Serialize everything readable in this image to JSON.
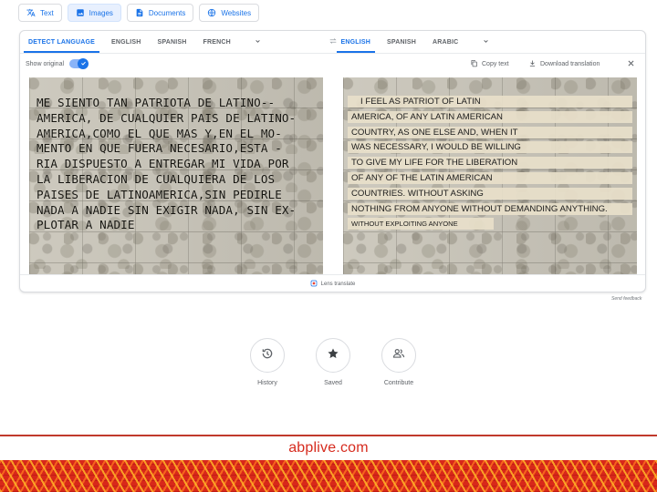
{
  "modes": [
    {
      "label": "Text",
      "icon": "translate-icon",
      "active": false
    },
    {
      "label": "Images",
      "icon": "image-icon",
      "active": true
    },
    {
      "label": "Documents",
      "icon": "document-icon",
      "active": false
    },
    {
      "label": "Websites",
      "icon": "globe-icon",
      "active": false
    }
  ],
  "source_langs": [
    "DETECT LANGUAGE",
    "ENGLISH",
    "SPANISH",
    "FRENCH"
  ],
  "target_langs": [
    "ENGLISH",
    "SPANISH",
    "ARABIC"
  ],
  "options": {
    "show_original": "Show original",
    "show_original_on": true,
    "copy_text": "Copy text",
    "download": "Download translation"
  },
  "original_lines": [
    " ME SIENTO TAN PATRIOTA DE LATINO--",
    "AMERICA, DE CUALQUIER PAIS DE LATINO-",
    "AMERICA,COMO EL QUE MAS Y,EN EL MO-",
    "MENTO EN QUE FUERA NECESARIO,ESTA -",
    "RIA DISPUESTO A ENTREGAR MI VIDA POR",
    "LA LIBERACION DE CUALQUIERA DE LOS",
    "PAISES DE LATINOAMERICA,SIN PEDIRLE",
    "NADA A NADIE SIN EXIGIR NADA, SIN EX-",
    "PLOTAR A NADIE"
  ],
  "translated_lines": [
    "I FEEL AS PATRIOT OF LATIN",
    "AMERICA, OF ANY LATIN AMERICAN",
    "COUNTRY, AS ONE ELSE AND, WHEN IT",
    "WAS NECESSARY, I WOULD BE WILLING",
    "TO GIVE MY LIFE FOR THE LIBERATION",
    "OF ANY OF THE LATIN AMERICAN",
    "COUNTRIES. WITHOUT ASKING",
    "NOTHING FROM ANYONE WITHOUT DEMANDING ANYTHING.",
    "WITHOUT EXPLOITING ANYONE"
  ],
  "lens_label": "Lens translate",
  "send_feedback": "Send feedback",
  "quick_actions": [
    {
      "label": "History",
      "icon": "history-icon"
    },
    {
      "label": "Saved",
      "icon": "star-icon"
    },
    {
      "label": "Contribute",
      "icon": "people-icon"
    }
  ],
  "watermark": "abplive.com",
  "colors": {
    "accent": "#1a73e8",
    "brand": "#d62b1e"
  }
}
